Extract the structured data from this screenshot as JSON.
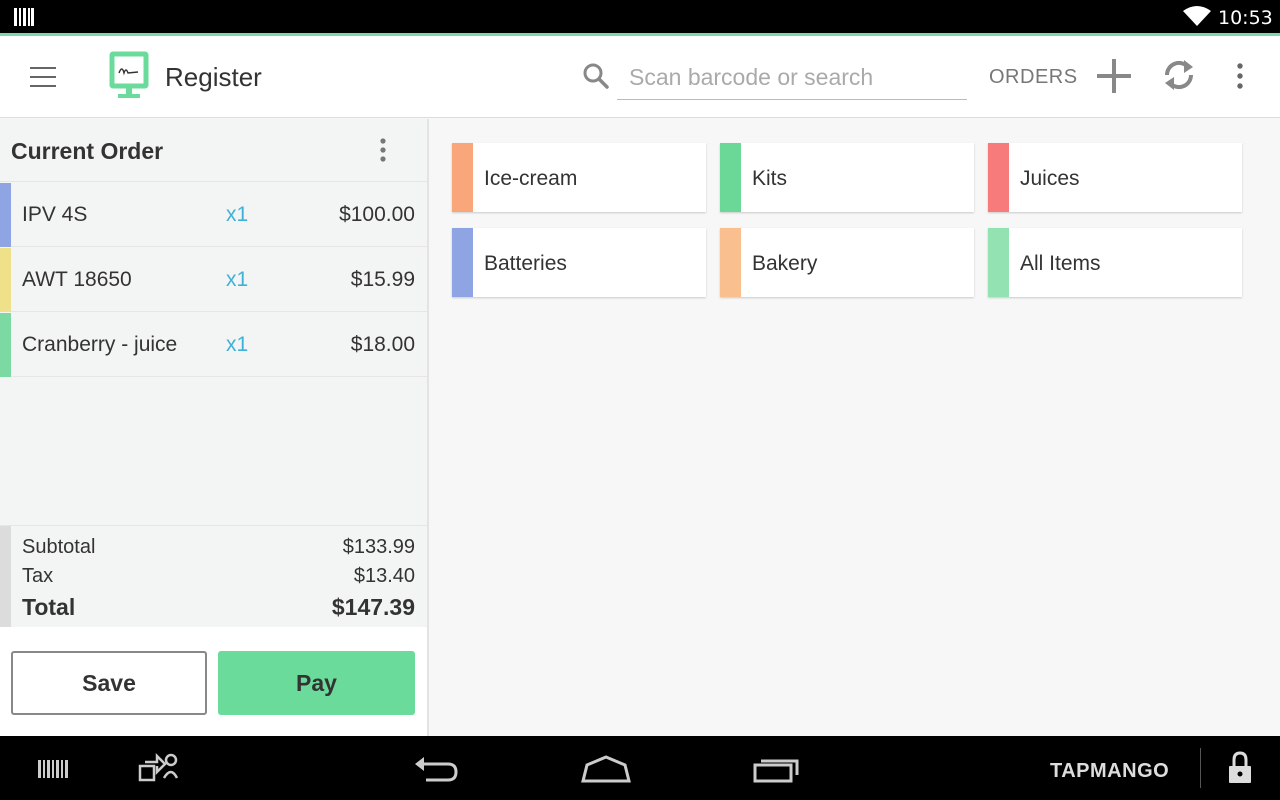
{
  "status_bar": {
    "time": "10:53"
  },
  "app_bar": {
    "title": "Register",
    "search_placeholder": "Scan barcode or search",
    "orders_label": "ORDERS"
  },
  "current_order": {
    "title": "Current Order",
    "items": [
      {
        "name": "IPV 4S",
        "qty": "x1",
        "price": "$100.00",
        "color": "#8fa5e3"
      },
      {
        "name": "AWT 18650",
        "qty": "x1",
        "price": "$15.99",
        "color": "#efe08a"
      },
      {
        "name": "Cranberry - juice",
        "qty": "x1",
        "price": "$18.00",
        "color": "#7dd9a2"
      }
    ],
    "subtotal_label": "Subtotal",
    "subtotal_value": "$133.99",
    "tax_label": "Tax",
    "tax_value": "$13.40",
    "total_label": "Total",
    "total_value": "$147.39",
    "save_label": "Save",
    "pay_label": "Pay"
  },
  "categories": [
    {
      "label": "Ice-cream",
      "color": "#f9a77a"
    },
    {
      "label": "Kits",
      "color": "#6bd898"
    },
    {
      "label": "Juices",
      "color": "#f77b7b"
    },
    {
      "label": "Batteries",
      "color": "#8fa5e3"
    },
    {
      "label": "Bakery",
      "color": "#f9bf8f"
    },
    {
      "label": "All Items",
      "color": "#92e3b1"
    }
  ],
  "nav_bar": {
    "brand": "TAPMANGO"
  },
  "colors": {
    "accent_green": "#6bdb9b",
    "qty_blue": "#3fb1d8"
  }
}
